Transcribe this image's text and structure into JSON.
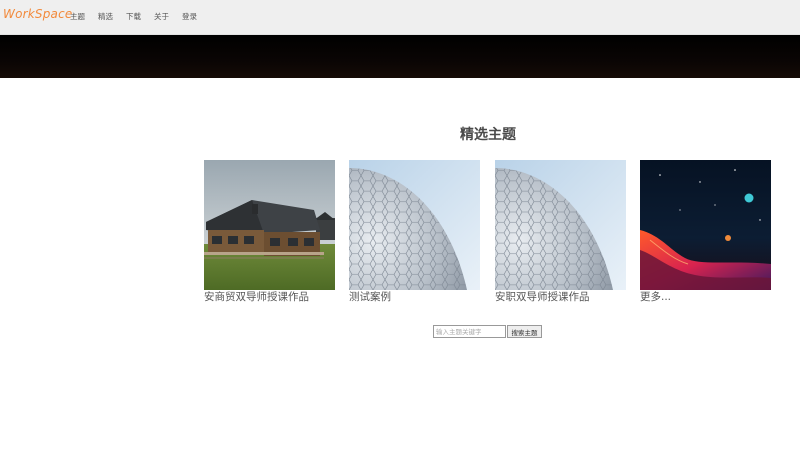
{
  "nav": {
    "brand": "WorkSpace",
    "links": [
      "主题",
      "精选",
      "下载",
      "关于",
      "登录"
    ]
  },
  "featured": {
    "title": "精选主题",
    "cards": [
      {
        "caption": "安商贸双导师授课作品",
        "image": "house-render"
      },
      {
        "caption": "测试案例",
        "image": "hex-dome"
      },
      {
        "caption": "安职双导师授课作品",
        "image": "hex-dome"
      },
      {
        "caption": "更多...",
        "image": "space-landscape"
      }
    ]
  },
  "search": {
    "placeholder": "输入主题关键字",
    "button_label": "搜索主题"
  },
  "colors": {
    "brand": "#f28a3c",
    "navbar_bg": "#efefef",
    "banner_bg": "#000000",
    "title_text": "#4a4a4a"
  }
}
